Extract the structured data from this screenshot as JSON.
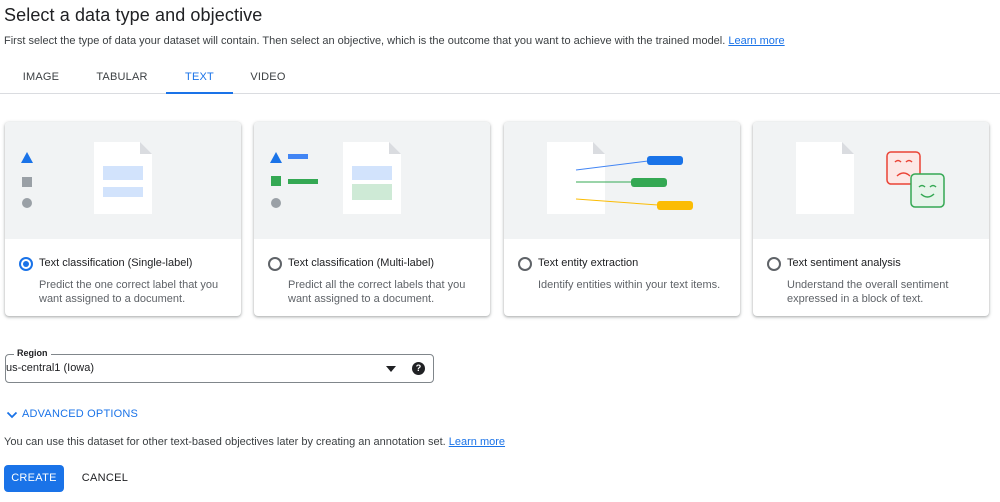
{
  "header": {
    "title": "Select a data type and objective",
    "subtitle": "First select the type of data your dataset will contain. Then select an objective, which is the outcome that you want to achieve with the trained model.",
    "learn_more": "Learn more"
  },
  "tabs": [
    {
      "label": "IMAGE",
      "active": false
    },
    {
      "label": "TABULAR",
      "active": false
    },
    {
      "label": "TEXT",
      "active": true
    },
    {
      "label": "VIDEO",
      "active": false
    }
  ],
  "objectives": [
    {
      "title": "Text classification (Single-label)",
      "description": "Predict the one correct label that you want assigned to a document.",
      "selected": true,
      "icon": "single-label-illustration"
    },
    {
      "title": "Text classification (Multi-label)",
      "description": "Predict all the correct labels that you want assigned to a document.",
      "selected": false,
      "icon": "multi-label-illustration"
    },
    {
      "title": "Text entity extraction",
      "description": "Identify entities within your text items.",
      "selected": false,
      "icon": "entity-extraction-illustration"
    },
    {
      "title": "Text sentiment analysis",
      "description": "Understand the overall sentiment expressed in a block of text.",
      "selected": false,
      "icon": "sentiment-illustration"
    }
  ],
  "region": {
    "label": "Region",
    "value": "us-central1 (Iowa)",
    "icon": "help-icon",
    "help_glyph": "?"
  },
  "advanced_options": {
    "label": "ADVANCED OPTIONS",
    "icon": "chevron-down-icon"
  },
  "footnote": {
    "text": "You can use this dataset for other text-based objectives later by creating an annotation set.",
    "learn_more": "Learn more"
  },
  "actions": {
    "create": "CREATE",
    "cancel": "CANCEL"
  },
  "colors": {
    "accent": "#1a73e8",
    "green": "#34a853",
    "yellow": "#fbbc04",
    "red": "#ea4335",
    "illustration_bg": "#f1f3f4"
  }
}
